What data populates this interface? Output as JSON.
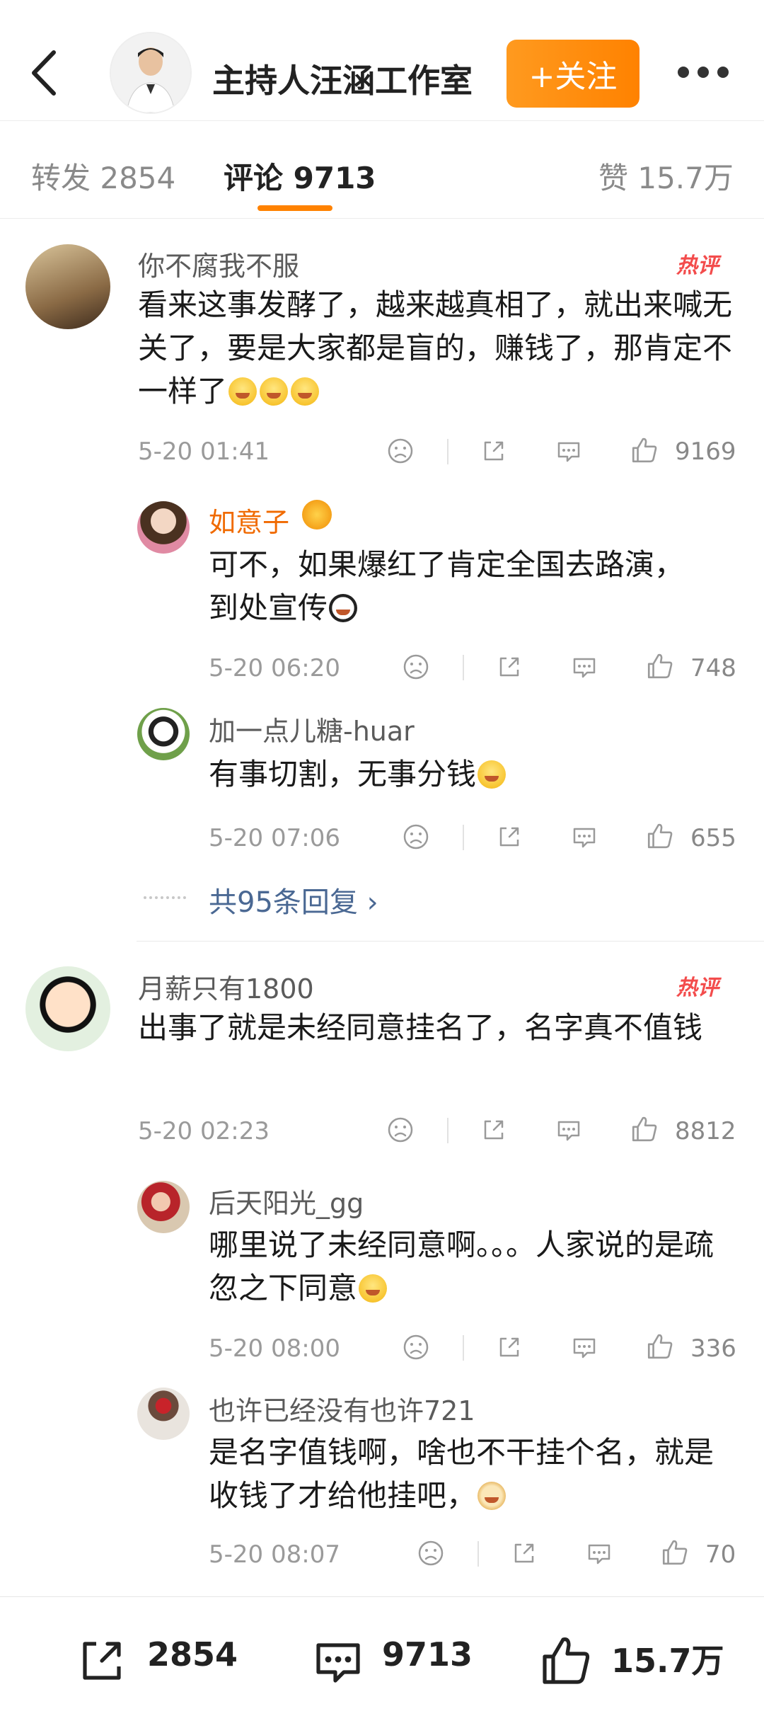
{
  "header": {
    "account_name": "主持人汪涵工作室",
    "follow_label": "+关注"
  },
  "tabs": {
    "repost": "转发 2854",
    "comment": "评论 9713",
    "like": "赞 15.7万"
  },
  "comments": [
    {
      "user": "你不腐我不服",
      "hot_badge": "热评",
      "text": "看来这事发酵了，越来越真相了，就出来喊无关了，要是大家都是盲的，赚钱了，那肯定不一样了",
      "time": "5-20 01:41",
      "likes": "9169",
      "replies": [
        {
          "user": "如意子",
          "text": "可不，如果爆红了肯定全国去路演，到处宣传",
          "time": "5-20 06:20",
          "likes": "748"
        },
        {
          "user": "加一点儿糖-huar",
          "text": "有事切割，无事分钱",
          "time": "5-20 07:06",
          "likes": "655"
        }
      ],
      "more_replies": "共95条回复"
    },
    {
      "user": "月薪只有1800",
      "hot_badge": "热评",
      "text": "出事了就是未经同意挂名了，名字真不值钱",
      "time": "5-20 02:23",
      "likes": "8812",
      "replies": [
        {
          "user": "后天阳光_gg",
          "text": "哪里说了未经同意啊。。。人家说的是疏忽之下同意",
          "time": "5-20 08:00",
          "likes": "336"
        },
        {
          "user": "也许已经没有也许721",
          "text": "是名字值钱啊，啥也不干挂个名，就是收钱了才给他挂吧，",
          "time": "5-20 08:07",
          "likes": "70"
        }
      ]
    }
  ],
  "bottom_bar": {
    "repost_count": "2854",
    "comment_count": "9713",
    "like_count": "15.7万"
  },
  "colors": {
    "accent": "#ff8200",
    "hot": "#f34c4c",
    "link": "#4a6893"
  }
}
